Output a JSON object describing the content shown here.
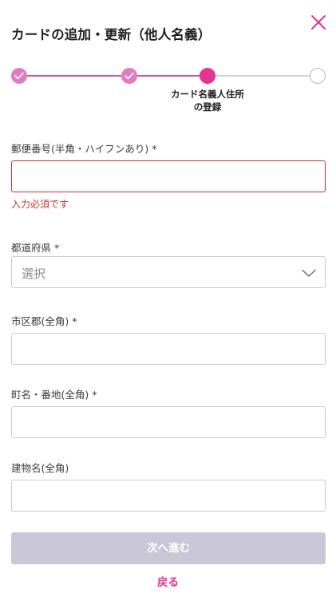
{
  "header": {
    "title": "カードの追加・更新（他人名義）"
  },
  "stepper": {
    "current_step_label": "カード名義人住所\nの登録",
    "current_step_line1": "カード名義人住所",
    "current_step_line2": "の登録",
    "steps_total": 4,
    "steps_completed": 2,
    "current_step": 3
  },
  "form": {
    "postal_code": {
      "label": "郵便番号(半角・ハイフンあり) *",
      "value": "",
      "error": "入力必須です"
    },
    "prefecture": {
      "label": "都道府県 *",
      "selected": "選択"
    },
    "city": {
      "label": "市区郡(全角) *",
      "value": ""
    },
    "town": {
      "label": "町名・番地(全角) *",
      "value": ""
    },
    "building": {
      "label": "建物名(全角)",
      "value": ""
    }
  },
  "actions": {
    "next_label": "次へ進む",
    "back_label": "戻る"
  },
  "colors": {
    "accent": "#e5338f",
    "done_step": "#e07cc0",
    "error": "#c8322f",
    "disabled_button": "#c9c6d6"
  },
  "icons": {
    "close": "close-icon",
    "check": "check-icon",
    "dropdown": "chevron-down-icon"
  }
}
